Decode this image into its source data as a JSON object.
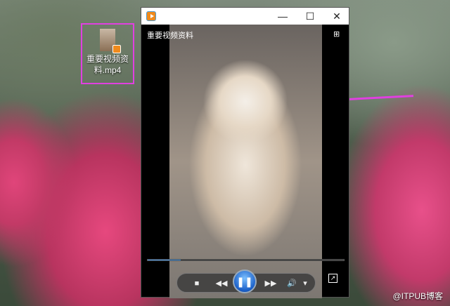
{
  "desktop": {
    "file_label": "重要视频资料.mp4"
  },
  "window": {
    "minimize": "—",
    "maximize": "☐",
    "close": "✕"
  },
  "player": {
    "title": "重要视频资料",
    "mode_icon": "⊞",
    "progress_percent": 17,
    "controls": {
      "stop": "■",
      "rewind": "◀◀",
      "pause": "❚❚",
      "forward": "▶▶",
      "volume": "🔊",
      "volume_menu": "▾",
      "fullscreen": "↗"
    }
  },
  "watermark": "@ITPUB博客",
  "colors": {
    "highlight": "#e040e0",
    "accent": "#3a8de0"
  }
}
